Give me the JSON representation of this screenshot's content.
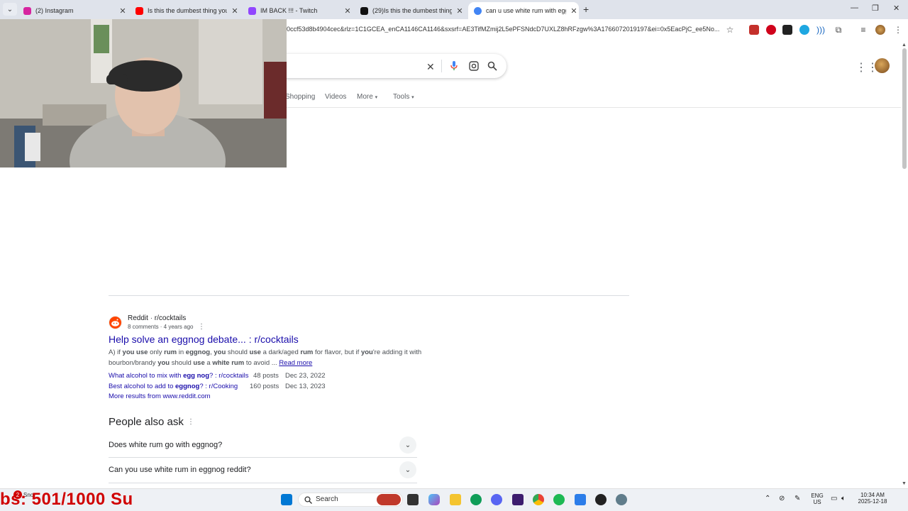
{
  "browser": {
    "tabs": [
      {
        "title": "(2) Instagram",
        "favicon_color": "#d6249f"
      },
      {
        "title": "Is this the dumbest thing you e",
        "favicon_color": "#ff0000"
      },
      {
        "title": "IM BACK !!! - Twitch",
        "favicon_color": "#9146ff"
      },
      {
        "title": "(29)Is this the dumbest thing yo",
        "favicon_color": "#111111"
      },
      {
        "title": "can u use white rum with eggn",
        "favicon_color": "#4285f4"
      }
    ],
    "new_tab_symbol": "+",
    "url": "0ccf53d8b4904cec&rlz=1C1GCEA_enCA1146CA1146&sxsrf=AE3TifMZmij2L5ePFSNdcD7UXLZ8hRFzgw%3A1766072019197&ei=0x5EacPjC_ee5No..."
  },
  "search_filters": [
    "Shopping",
    "Videos",
    "More",
    "Tools"
  ],
  "result": {
    "site": "Reddit",
    "subreddit": "r/cocktails",
    "meta": "8 comments · 4 years ago",
    "title": "Help solve an eggnog debate... : r/cocktails",
    "snippet_line1_parts": [
      {
        "t": "A) if "
      },
      {
        "t": "you use",
        "b": true
      },
      {
        "t": " only "
      },
      {
        "t": "rum",
        "b": true
      },
      {
        "t": " in "
      },
      {
        "t": "eggnog",
        "b": true
      },
      {
        "t": ", "
      },
      {
        "t": "you",
        "b": true
      },
      {
        "t": " should "
      },
      {
        "t": "use",
        "b": true
      },
      {
        "t": " a dark/aged "
      },
      {
        "t": "rum",
        "b": true
      },
      {
        "t": " for flavor, but if "
      },
      {
        "t": "you",
        "b": true
      },
      {
        "t": "'re adding it with"
      }
    ],
    "snippet_line2_parts": [
      {
        "t": "bourbon/brandy "
      },
      {
        "t": "you",
        "b": true
      },
      {
        "t": " should "
      },
      {
        "t": "use",
        "b": true
      },
      {
        "t": " a "
      },
      {
        "t": "white rum",
        "b": true
      },
      {
        "t": " to avoid ... "
      }
    ],
    "read_more": "Read more",
    "sublinks": [
      {
        "text_parts": [
          {
            "t": "What alcohol to mix with "
          },
          {
            "t": "egg nog",
            "b": true
          },
          {
            "t": "? : r/cocktails"
          }
        ],
        "posts": "48 posts",
        "date": "Dec 23, 2022"
      },
      {
        "text_parts": [
          {
            "t": "Best alcohol to add to "
          },
          {
            "t": "eggnog",
            "b": true
          },
          {
            "t": "? : r/Cooking"
          }
        ],
        "posts": "160 posts",
        "date": "Dec 13, 2023"
      }
    ],
    "more_results": "More results from www.reddit.com"
  },
  "people_also_ask": {
    "heading": "People also ask",
    "questions": [
      "Does white rum go with eggnog?",
      "Can you use white rum in eggnog reddit?"
    ]
  },
  "taskbar": {
    "search_placeholder": "Search",
    "language": "ENG",
    "region": "US",
    "time": "10:34 AM",
    "date": "2025-12-18"
  },
  "overlay": {
    "text": "bs: 501/1000  Su",
    "badge": "2",
    "under_text": "Sno"
  }
}
